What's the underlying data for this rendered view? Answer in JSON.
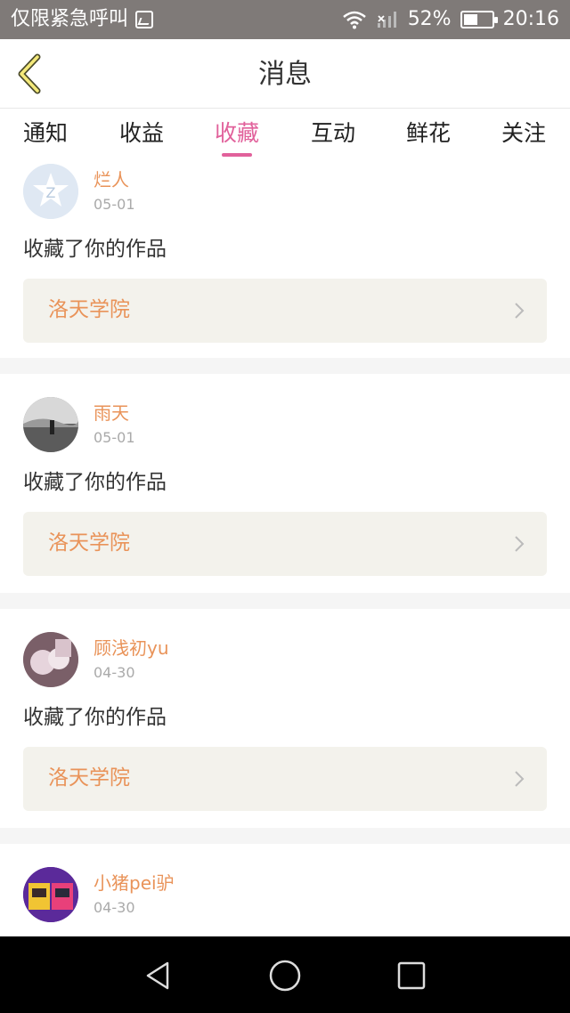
{
  "status_bar": {
    "carrier_text": "仅限紧急呼叫",
    "battery": "52%",
    "battery_level": 0.52,
    "time": "20:16",
    "icons": [
      "image-icon",
      "wifi-icon",
      "signal-icon",
      "battery-icon"
    ]
  },
  "header": {
    "title": "消息",
    "back_icon": "chevron-left-icon"
  },
  "tabs": [
    {
      "label": "通知",
      "active": false
    },
    {
      "label": "收益",
      "active": false
    },
    {
      "label": "收藏",
      "active": true
    },
    {
      "label": "互动",
      "active": false
    },
    {
      "label": "鲜花",
      "active": false
    },
    {
      "label": "关注",
      "active": false
    }
  ],
  "accent_color": "#e1619b",
  "name_color": "#e99359",
  "messages": [
    {
      "user": "烂人",
      "date": "05-01",
      "action": "收藏了你的作品",
      "work": "洛天学院"
    },
    {
      "user": "雨天",
      "date": "05-01",
      "action": "收藏了你的作品",
      "work": "洛天学院"
    },
    {
      "user": "顾浅初yu",
      "date": "04-30",
      "action": "收藏了你的作品",
      "work": "洛天学院"
    },
    {
      "user": "小猪pei驴",
      "date": "04-30"
    }
  ],
  "nav_bar": {
    "icons": [
      "back-triangle-icon",
      "home-circle-icon",
      "recents-square-icon"
    ]
  }
}
